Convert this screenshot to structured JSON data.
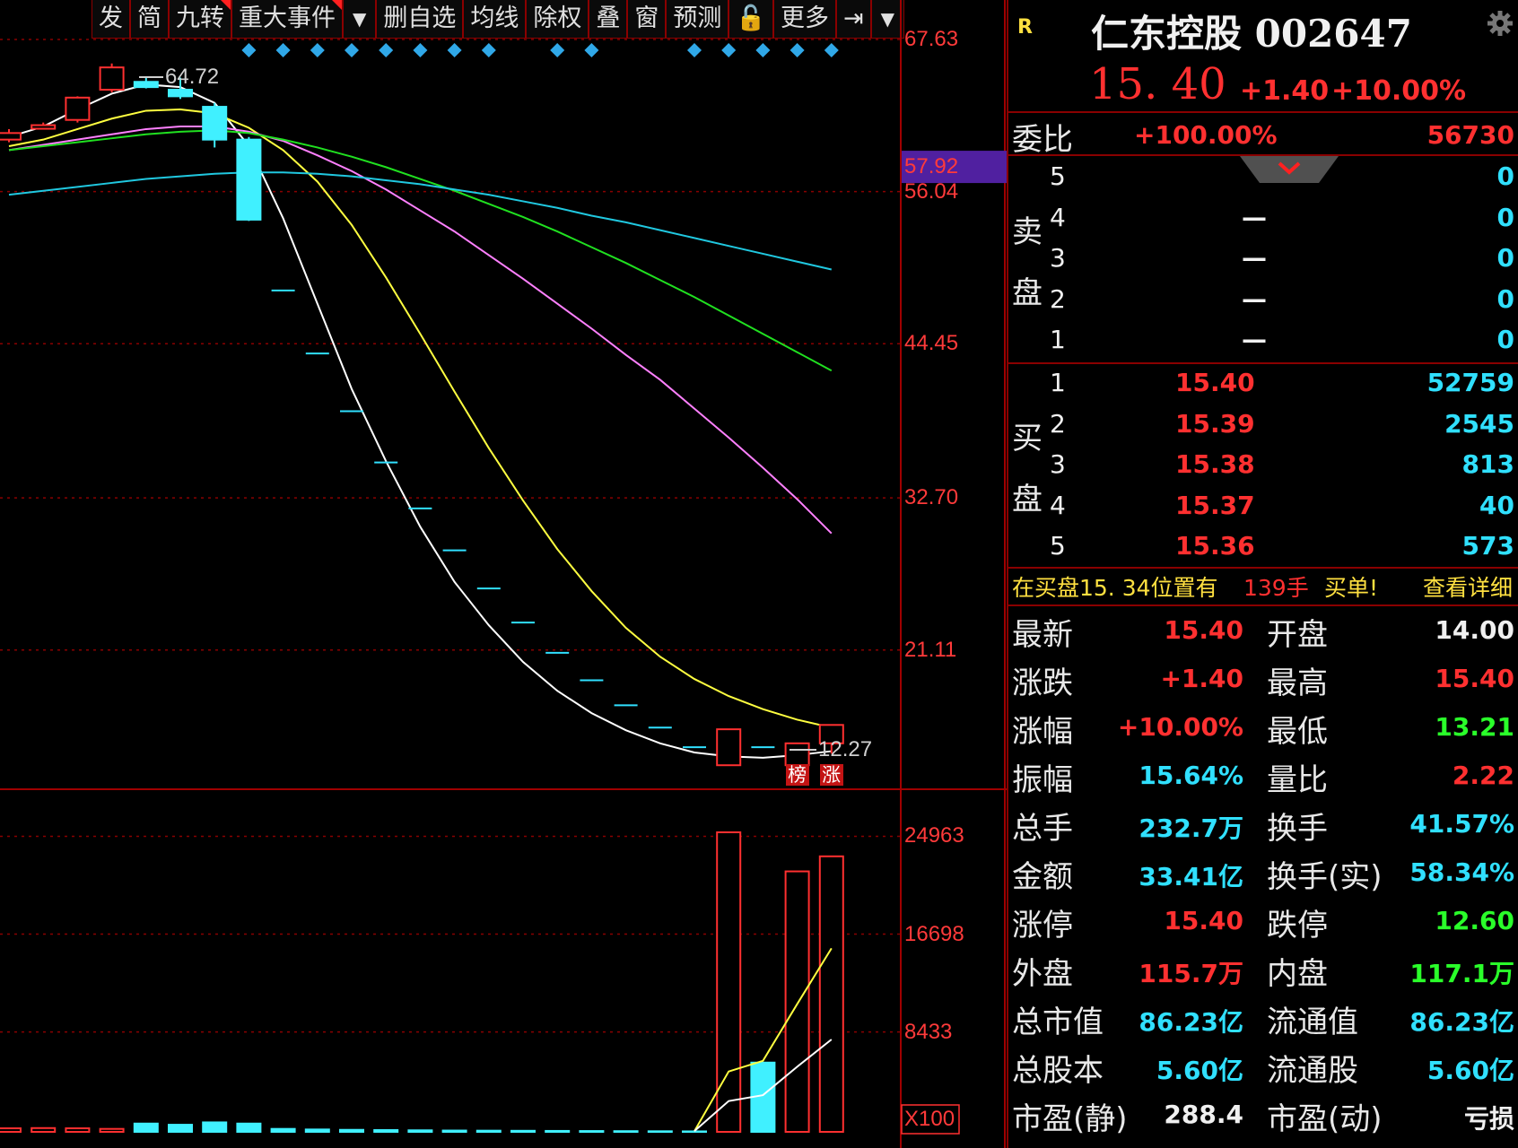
{
  "toolbar": {
    "items": [
      {
        "label": "发",
        "flag": false
      },
      {
        "label": "简",
        "flag": false
      },
      {
        "label": "九转",
        "flag": true
      },
      {
        "label": "重大事件",
        "flag": true
      },
      {
        "label": "▼",
        "flag": false,
        "dd": true
      },
      {
        "label": "删自选",
        "flag": false
      },
      {
        "label": "均线",
        "flag": false
      },
      {
        "label": "除权",
        "flag": false
      },
      {
        "label": "叠",
        "flag": false
      },
      {
        "label": "窗",
        "flag": false
      },
      {
        "label": "预测",
        "flag": false
      },
      {
        "label": "🔓",
        "flag": false
      },
      {
        "label": "更多",
        "flag": false
      },
      {
        "label": "⇥",
        "flag": false
      },
      {
        "label": "▼",
        "flag": false,
        "dd": true
      }
    ]
  },
  "chart_data": {
    "type": "candlestick",
    "price_axis": {
      "ticks": [
        "67.63",
        "56.04",
        "44.45",
        "32.70",
        "21.11"
      ],
      "current": "57.92",
      "min": 10.5,
      "max": 67.63
    },
    "volume_axis": {
      "ticks": [
        "24963",
        "16698",
        "8433"
      ],
      "unit": "X100"
    },
    "high_label": "64.72",
    "low_label": "12.27",
    "candles": [
      {
        "o": 60.0,
        "c": 60.5,
        "h": 60.8,
        "l": 59.8,
        "up": true
      },
      {
        "o": 60.9,
        "c": 61.1,
        "h": 61.3,
        "l": 60.8,
        "up": true
      },
      {
        "o": 61.5,
        "c": 63.2,
        "h": 63.3,
        "l": 61.3,
        "up": true
      },
      {
        "o": 63.8,
        "c": 65.5,
        "h": 65.8,
        "l": 63.6,
        "up": true
      },
      {
        "o": 64.4,
        "c": 64.0,
        "h": 64.8,
        "l": 63.9,
        "up": false
      },
      {
        "o": 63.8,
        "c": 63.3,
        "h": 64.72,
        "l": 63.1,
        "up": false
      },
      {
        "o": 62.5,
        "c": 60.0,
        "h": 62.8,
        "l": 59.4,
        "up": false
      },
      {
        "o": 60.0,
        "c": 53.9,
        "h": 60.2,
        "l": 53.8,
        "up": false
      },
      {
        "o": 48.5,
        "c": 48.5,
        "h": 48.5,
        "l": 48.5,
        "flat": true
      },
      {
        "o": 43.7,
        "c": 43.7,
        "h": 43.7,
        "l": 43.7,
        "flat": true
      },
      {
        "o": 39.3,
        "c": 39.3,
        "h": 39.3,
        "l": 39.3,
        "flat": true
      },
      {
        "o": 35.4,
        "c": 35.4,
        "h": 35.4,
        "l": 35.4,
        "flat": true
      },
      {
        "o": 31.9,
        "c": 31.9,
        "h": 31.9,
        "l": 31.9,
        "flat": true
      },
      {
        "o": 28.7,
        "c": 28.7,
        "h": 28.7,
        "l": 28.7,
        "flat": true
      },
      {
        "o": 25.8,
        "c": 25.8,
        "h": 25.8,
        "l": 25.8,
        "flat": true
      },
      {
        "o": 23.2,
        "c": 23.2,
        "h": 23.2,
        "l": 23.2,
        "flat": true
      },
      {
        "o": 20.9,
        "c": 20.9,
        "h": 20.9,
        "l": 20.9,
        "flat": true
      },
      {
        "o": 18.8,
        "c": 18.8,
        "h": 18.8,
        "l": 18.8,
        "flat": true
      },
      {
        "o": 16.9,
        "c": 16.9,
        "h": 16.9,
        "l": 16.9,
        "flat": true
      },
      {
        "o": 15.2,
        "c": 15.2,
        "h": 15.2,
        "l": 15.2,
        "flat": true
      },
      {
        "o": 13.7,
        "c": 13.7,
        "h": 13.7,
        "l": 13.7,
        "flat": true
      },
      {
        "o": 12.33,
        "c": 15.07,
        "h": 15.07,
        "l": 12.33,
        "up": true
      },
      {
        "o": 13.7,
        "c": 13.7,
        "h": 13.7,
        "l": 13.7,
        "flat": true
      },
      {
        "o": 12.33,
        "c": 14.0,
        "h": 14.0,
        "l": 12.27,
        "up": true
      },
      {
        "o": 14.0,
        "c": 15.4,
        "h": 15.4,
        "l": 13.21,
        "up": true
      }
    ],
    "ma_lines": [
      {
        "color": "#ffffff",
        "values": [
          60.2,
          61.0,
          62.3,
          63.5,
          64.2,
          64.0,
          62.8,
          59.5,
          54.0,
          47.5,
          41.0,
          35.5,
          30.5,
          26.3,
          23.0,
          20.2,
          18.0,
          16.3,
          15.0,
          14.0,
          13.3,
          13.0,
          12.9,
          13.1,
          13.4
        ]
      },
      {
        "color": "#ffff40",
        "values": [
          59.5,
          60.0,
          60.8,
          61.6,
          62.2,
          62.3,
          62.0,
          60.9,
          59.2,
          56.8,
          53.5,
          49.5,
          45.2,
          40.8,
          36.5,
          32.5,
          28.8,
          25.6,
          22.8,
          20.6,
          18.9,
          17.6,
          16.6,
          15.8,
          15.2
        ]
      },
      {
        "color": "#ff80ff",
        "values": [
          59.2,
          59.6,
          60.0,
          60.4,
          60.8,
          61.0,
          61.0,
          60.6,
          59.9,
          58.8,
          57.6,
          56.2,
          54.6,
          53.0,
          51.2,
          49.4,
          47.5,
          45.6,
          43.6,
          41.7,
          39.5,
          37.3,
          35.0,
          32.6,
          30.0
        ]
      },
      {
        "color": "#20e020",
        "values": [
          59.2,
          59.5,
          59.8,
          60.1,
          60.4,
          60.6,
          60.7,
          60.5,
          60.0,
          59.4,
          58.7,
          57.9,
          57.0,
          56.1,
          55.1,
          54.1,
          53.0,
          51.8,
          50.6,
          49.3,
          48.0,
          46.6,
          45.2,
          43.8,
          42.4
        ]
      },
      {
        "color": "#20c8e0",
        "values": [
          55.8,
          56.1,
          56.4,
          56.7,
          57.0,
          57.2,
          57.4,
          57.5,
          57.5,
          57.4,
          57.2,
          56.9,
          56.6,
          56.2,
          55.8,
          55.3,
          54.8,
          54.2,
          53.7,
          53.1,
          52.5,
          51.9,
          51.3,
          50.7,
          50.1
        ]
      }
    ],
    "volume": [
      {
        "v": 300,
        "up": true
      },
      {
        "v": 320,
        "up": true
      },
      {
        "v": 300,
        "up": true
      },
      {
        "v": 250,
        "up": true
      },
      {
        "v": 700,
        "up": false
      },
      {
        "v": 600,
        "up": false
      },
      {
        "v": 800,
        "up": false
      },
      {
        "v": 700,
        "up": false
      },
      {
        "v": 250,
        "up": false
      },
      {
        "v": 200,
        "up": false
      },
      {
        "v": 170,
        "up": false
      },
      {
        "v": 150,
        "up": false
      },
      {
        "v": 130,
        "up": false
      },
      {
        "v": 110,
        "up": false
      },
      {
        "v": 100,
        "up": false
      },
      {
        "v": 90,
        "up": false
      },
      {
        "v": 80,
        "up": false
      },
      {
        "v": 70,
        "up": false
      },
      {
        "v": 60,
        "up": false
      },
      {
        "v": 50,
        "up": false
      },
      {
        "v": 40,
        "up": false
      },
      {
        "v": 25300,
        "up": true
      },
      {
        "v": 5850,
        "up": false
      },
      {
        "v": 22000,
        "up": true
      },
      {
        "v": 23270,
        "up": true
      }
    ],
    "volume_ma": [
      {
        "color": "#ffff40",
        "values": [
          null,
          null,
          null,
          null,
          null,
          null,
          null,
          null,
          null,
          null,
          null,
          null,
          null,
          null,
          null,
          null,
          null,
          null,
          null,
          null,
          60,
          5100,
          6000,
          10800,
          15500
        ]
      },
      {
        "color": "#ffffff",
        "values": [
          null,
          null,
          null,
          null,
          null,
          null,
          null,
          null,
          null,
          null,
          null,
          null,
          null,
          null,
          null,
          null,
          null,
          null,
          null,
          null,
          70,
          2600,
          3100,
          5500,
          7800
        ]
      }
    ],
    "event_diamonds": [
      7,
      8,
      9,
      10,
      11,
      12,
      13,
      14,
      16,
      17,
      20,
      21,
      22,
      23,
      24
    ],
    "badges": [
      "榜",
      "涨"
    ]
  },
  "stock": {
    "tag": "R",
    "title": "仁东控股 002647",
    "price": "15. 40",
    "change": "+1.40",
    "pct": "+10.00%"
  },
  "weibi": {
    "label": "委比",
    "pct": "+100.00%",
    "diff": "56730"
  },
  "sell": {
    "label1": "卖",
    "label2": "盘",
    "rows": [
      {
        "n": "5",
        "price": "",
        "vol": "0"
      },
      {
        "n": "4",
        "price": "—",
        "vol": "0"
      },
      {
        "n": "3",
        "price": "—",
        "vol": "0"
      },
      {
        "n": "2",
        "price": "—",
        "vol": "0"
      },
      {
        "n": "1",
        "price": "—",
        "vol": "0"
      }
    ]
  },
  "buy": {
    "label1": "买",
    "label2": "盘",
    "rows": [
      {
        "n": "1",
        "price": "15.40",
        "vol": "52759"
      },
      {
        "n": "2",
        "price": "15.39",
        "vol": "2545"
      },
      {
        "n": "3",
        "price": "15.38",
        "vol": "813"
      },
      {
        "n": "4",
        "price": "15.37",
        "vol": "40"
      },
      {
        "n": "5",
        "price": "15.36",
        "vol": "573"
      }
    ]
  },
  "notice": {
    "text": "在买盘15. 34位置有",
    "qty": "139手",
    "action": "买单!",
    "link": "查看详细"
  },
  "stats": [
    {
      "l1": "最新",
      "v1": "15.40",
      "c1": "red",
      "l2": "开盘",
      "v2": "14.00",
      "c2": "white"
    },
    {
      "l1": "涨跌",
      "v1": "+1.40",
      "c1": "red",
      "l2": "最高",
      "v2": "15.40",
      "c2": "red"
    },
    {
      "l1": "涨幅",
      "v1": "+10.00%",
      "c1": "red",
      "l2": "最低",
      "v2": "13.21",
      "c2": "green"
    },
    {
      "l1": "振幅",
      "v1": "15.64%",
      "c1": "cyan",
      "l2": "量比",
      "v2": "2.22",
      "c2": "red"
    },
    {
      "l1": "总手",
      "v1": "232.7万",
      "c1": "cyan",
      "l2": "换手",
      "v2": "41.57%",
      "c2": "cyan"
    },
    {
      "l1": "金额",
      "v1": "33.41亿",
      "c1": "cyan",
      "l2": "换手(实)",
      "v2": "58.34%",
      "c2": "cyan"
    },
    {
      "l1": "涨停",
      "v1": "15.40",
      "c1": "red",
      "l2": "跌停",
      "v2": "12.60",
      "c2": "green"
    },
    {
      "l1": "外盘",
      "v1": "115.7万",
      "c1": "red",
      "l2": "内盘",
      "v2": "117.1万",
      "c2": "green"
    },
    {
      "l1": "总市值",
      "v1": "86.23亿",
      "c1": "cyan",
      "l2": "流通值",
      "v2": "86.23亿",
      "c2": "cyan"
    },
    {
      "l1": "总股本",
      "v1": "5.60亿",
      "c1": "cyan",
      "l2": "流通股",
      "v2": "5.60亿",
      "c2": "cyan"
    },
    {
      "l1": "市盈(静)",
      "v1": "288.4",
      "c1": "white",
      "l2": "市盈(动)",
      "v2": "亏损",
      "c2": "white"
    }
  ]
}
